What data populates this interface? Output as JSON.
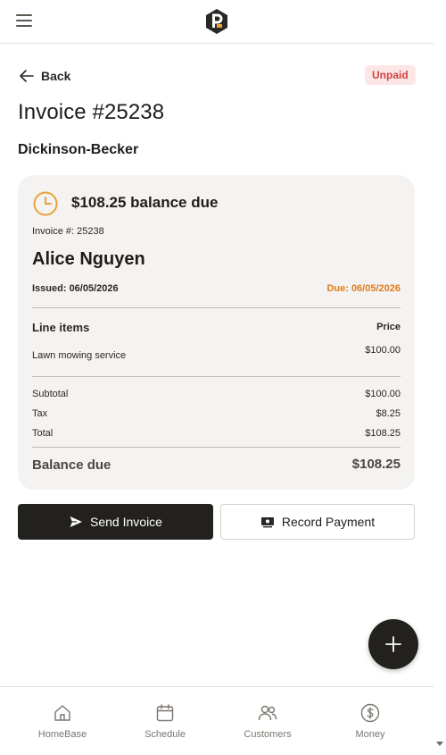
{
  "header": {
    "menu_icon": "hamburger-icon",
    "logo": "brand-logo"
  },
  "back": {
    "label": "Back",
    "icon": "arrow-left-icon"
  },
  "status": {
    "label": "Unpaid",
    "bg": "#fde6e6",
    "color": "#d14343"
  },
  "invoice": {
    "title": "Invoice #25238",
    "company": "Dickinson-Becker",
    "balance_heading": "$108.25 balance due",
    "number_text": "Invoice #: 25238",
    "customer": "Alice Nguyen",
    "issued": "Issued: 06/05/2026",
    "due": "Due: 06/05/2026",
    "due_color": "#e07b22",
    "line_items_header": "Line items",
    "price_header": "Price",
    "items": [
      {
        "description": "Lawn mowing service",
        "price": "$100.00"
      }
    ],
    "subtotal_label": "Subtotal",
    "subtotal": "$100.00",
    "tax_label": "Tax",
    "tax": "$8.25",
    "total_label": "Total",
    "total": "$108.25",
    "balance_label": "Balance due",
    "balance": "$108.25"
  },
  "actions": {
    "send": {
      "label": "Send Invoice",
      "icon": "send-icon"
    },
    "record": {
      "label": "Record Payment",
      "icon": "cash-icon"
    }
  },
  "fab": {
    "icon": "plus-icon"
  },
  "nav": [
    {
      "label": "HomeBase",
      "icon": "home-icon"
    },
    {
      "label": "Schedule",
      "icon": "calendar-icon"
    },
    {
      "label": "Customers",
      "icon": "users-icon"
    },
    {
      "label": "Money",
      "icon": "dollar-circle-icon"
    }
  ]
}
